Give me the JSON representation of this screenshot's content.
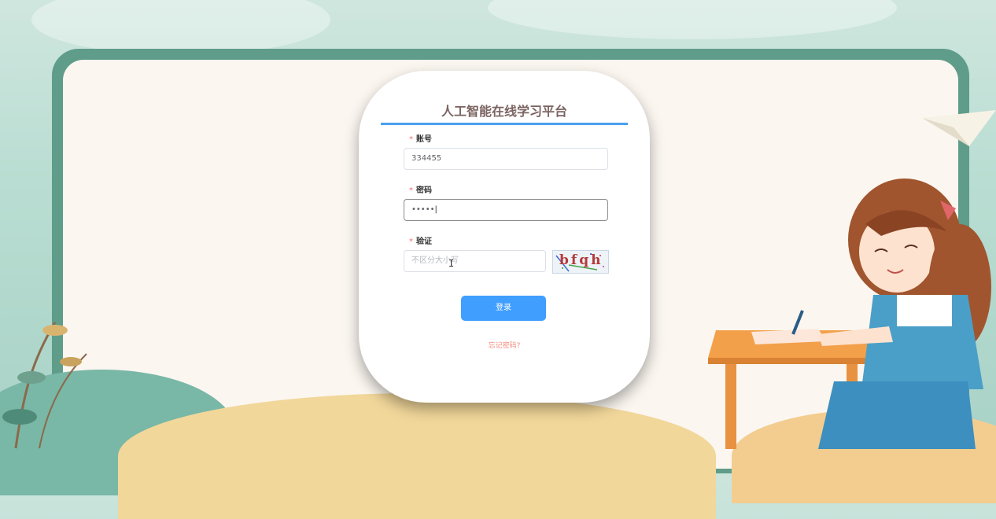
{
  "login": {
    "title": "人工智能在线学习平台",
    "required_mark": "*",
    "account_label": "账号",
    "account_value": "334455",
    "password_label": "密码",
    "password_value": "•••••",
    "captcha_label": "验证",
    "captcha_placeholder": "不区分大小写",
    "captcha_text": "bfqh",
    "login_button": "登录",
    "forgot_link": "忘记密码?"
  },
  "colors": {
    "accent": "#409eff",
    "title_line": "#4aa0f0",
    "forgot": "#f48a7b",
    "required": "#f56c6c",
    "frame": "#5f9c8a"
  }
}
